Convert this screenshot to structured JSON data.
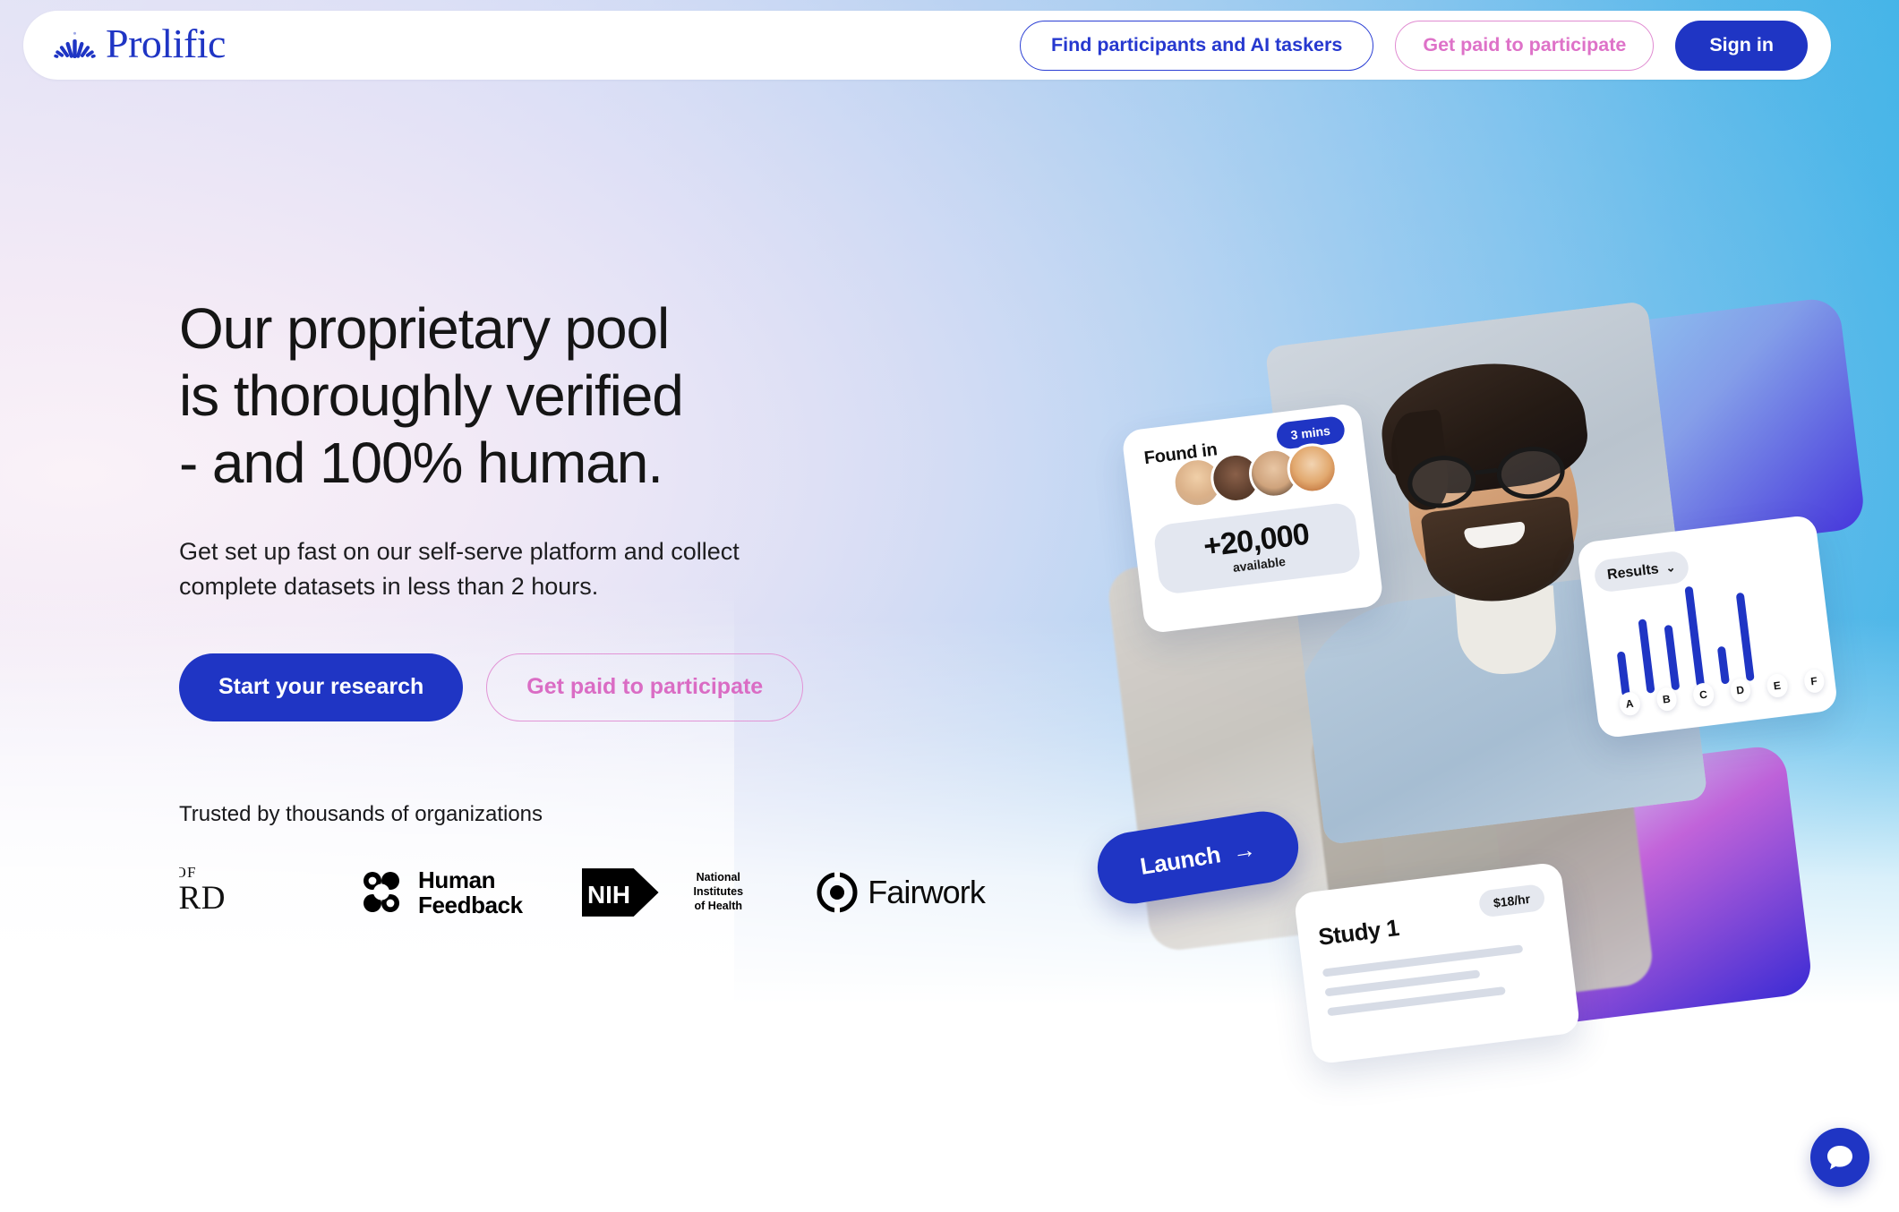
{
  "header": {
    "logo_text": "Prolific",
    "logo_icon": "prolific-fan-logo",
    "nav": {
      "find_participants_label": "Find participants and AI taskers",
      "get_paid_label": "Get paid to participate",
      "sign_in_label": "Sign in"
    }
  },
  "hero": {
    "title_lines": [
      "Our proprietary pool",
      "is thoroughly verified",
      "- and 100% human."
    ],
    "subtitle_lines": [
      "Get set up fast on our self-serve platform and collect",
      "complete datasets in less than 2 hours."
    ],
    "cta_primary_label": "Start your research",
    "cta_secondary_label": "Get paid to participate",
    "trusted_label": "Trusted by thousands of organizations",
    "logos": [
      {
        "name": "university-of-oxford",
        "line1": "ERSITY OF",
        "line2": "XFORD"
      },
      {
        "name": "human-feedback",
        "line1": "Human",
        "line2": "Feedback"
      },
      {
        "name": "nih",
        "mark": "NIH",
        "line1": "National Institutes",
        "line2": "of Health"
      },
      {
        "name": "fairwork",
        "text": "Fairwork"
      }
    ]
  },
  "illustration": {
    "found_card": {
      "label": "Found in",
      "time_badge": "3 mins",
      "stat_value": "+20,000",
      "stat_label": "available",
      "avatar_count": 4
    },
    "results_card": {
      "label": "Results",
      "chevron": "⌄"
    },
    "launch_button": {
      "label": "Launch",
      "arrow": "→"
    },
    "study_card": {
      "title": "Study 1",
      "rate_badge": "$18/hr"
    }
  },
  "chat": {
    "icon": "chat-bubble-icon"
  },
  "colors": {
    "brand_blue": "#1f35c4",
    "accent_pink": "#da6cc4",
    "text_dark": "#151515",
    "gradient_left": "#f7f0f6",
    "gradient_right": "#29aee5"
  },
  "chart_data": {
    "type": "bar",
    "title": "Results",
    "categories": [
      "A",
      "B",
      "C",
      "D",
      "E",
      "F"
    ],
    "values": [
      42,
      70,
      62,
      96,
      36,
      84
    ],
    "xlabel": "",
    "ylabel": "",
    "ylim": [
      0,
      100
    ],
    "grid": false,
    "legend": "none",
    "series_color": "#1f35c4"
  }
}
